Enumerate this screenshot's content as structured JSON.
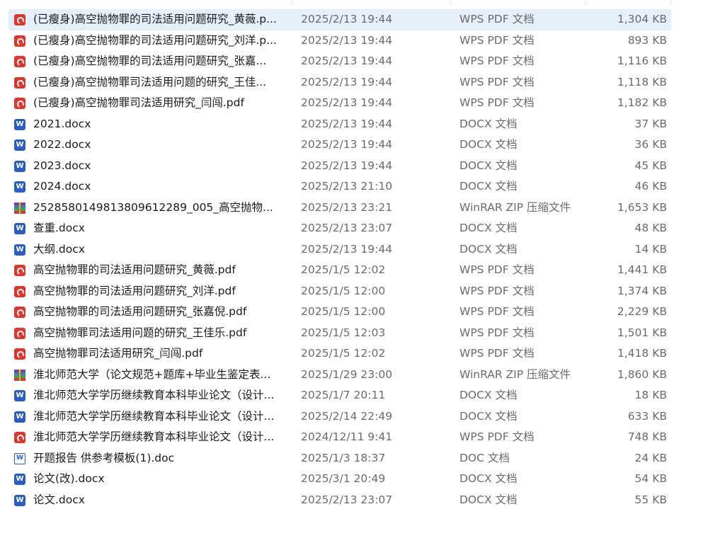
{
  "files": [
    {
      "name": "(已瘦身)高空抛物罪的司法适用问题研究_黄薇.p...",
      "date": "2025/2/13 19:44",
      "type": "WPS PDF 文档",
      "size": "1,304 KB",
      "icon": "pdf-icon",
      "selected": true
    },
    {
      "name": "(已瘦身)高空抛物罪的司法适用问题研究_刘洋.p...",
      "date": "2025/2/13 19:44",
      "type": "WPS PDF 文档",
      "size": "893 KB",
      "icon": "pdf-icon"
    },
    {
      "name": "(已瘦身)高空抛物罪的司法适用问题研究_张嘉...",
      "date": "2025/2/13 19:44",
      "type": "WPS PDF 文档",
      "size": "1,116 KB",
      "icon": "pdf-icon"
    },
    {
      "name": "(已瘦身)高空抛物罪司法适用问题的研究_王佳...",
      "date": "2025/2/13 19:44",
      "type": "WPS PDF 文档",
      "size": "1,118 KB",
      "icon": "pdf-icon"
    },
    {
      "name": "(已瘦身)高空抛物罪司法适用研究_闫闯.pdf",
      "date": "2025/2/13 19:44",
      "type": "WPS PDF 文档",
      "size": "1,182 KB",
      "icon": "pdf-icon"
    },
    {
      "name": "2021.docx",
      "date": "2025/2/13 19:44",
      "type": "DOCX 文档",
      "size": "37 KB",
      "icon": "docx-icon"
    },
    {
      "name": "2022.docx",
      "date": "2025/2/13 19:44",
      "type": "DOCX 文档",
      "size": "36 KB",
      "icon": "docx-icon"
    },
    {
      "name": "2023.docx",
      "date": "2025/2/13 19:44",
      "type": "DOCX 文档",
      "size": "45 KB",
      "icon": "docx-icon"
    },
    {
      "name": "2024.docx",
      "date": "2025/2/13 21:10",
      "type": "DOCX 文档",
      "size": "46 KB",
      "icon": "docx-icon"
    },
    {
      "name": "252858014981380961228​9_005_高空抛物...",
      "date": "2025/2/13 23:21",
      "type": "WinRAR ZIP 压缩文件",
      "size": "1,653 KB",
      "icon": "zip-icon"
    },
    {
      "name": "查重.docx",
      "date": "2025/2/13 23:07",
      "type": "DOCX 文档",
      "size": "48 KB",
      "icon": "docx-icon"
    },
    {
      "name": "大纲.docx",
      "date": "2025/2/13 19:44",
      "type": "DOCX 文档",
      "size": "14 KB",
      "icon": "docx-icon"
    },
    {
      "name": "高空抛物罪的司法适用问题研究_黄薇.pdf",
      "date": "2025/1/5 12:02",
      "type": "WPS PDF 文档",
      "size": "1,441 KB",
      "icon": "pdf-icon"
    },
    {
      "name": "高空抛物罪的司法适用问题研究_刘洋.pdf",
      "date": "2025/1/5 12:00",
      "type": "WPS PDF 文档",
      "size": "1,374 KB",
      "icon": "pdf-icon"
    },
    {
      "name": "高空抛物罪的司法适用问题研究_张嘉倪.pdf",
      "date": "2025/1/5 12:00",
      "type": "WPS PDF 文档",
      "size": "2,229 KB",
      "icon": "pdf-icon"
    },
    {
      "name": "高空抛物罪司法适用问题的研究_王佳乐.pdf",
      "date": "2025/1/5 12:03",
      "type": "WPS PDF 文档",
      "size": "1,501 KB",
      "icon": "pdf-icon"
    },
    {
      "name": "高空抛物罪司法适用研究_闫闯.pdf",
      "date": "2025/1/5 12:02",
      "type": "WPS PDF 文档",
      "size": "1,418 KB",
      "icon": "pdf-icon"
    },
    {
      "name": "淮北师范大学（论文规范+题库+毕业生鉴定表...",
      "date": "2025/1/29 23:00",
      "type": "WinRAR ZIP 压缩文件",
      "size": "1,860 KB",
      "icon": "zip-icon"
    },
    {
      "name": "淮北师范大学学历继续教育本科毕业论文（设计...",
      "date": "2025/1/7 20:11",
      "type": "DOCX 文档",
      "size": "18 KB",
      "icon": "docx-icon"
    },
    {
      "name": "淮北师范大学学历继续教育本科毕业论文（设计...",
      "date": "2025/2/14 22:49",
      "type": "DOCX 文档",
      "size": "633 KB",
      "icon": "docx-icon"
    },
    {
      "name": "淮北师范大学学历继续教育本科毕业论文（设计...",
      "date": "2024/12/11 9:41",
      "type": "WPS PDF 文档",
      "size": "748 KB",
      "icon": "pdf-icon"
    },
    {
      "name": "开题报告 供参考模板(1).doc",
      "date": "2025/1/3 18:37",
      "type": "DOC 文档",
      "size": "24 KB",
      "icon": "doc-icon"
    },
    {
      "name": "论文(改).docx",
      "date": "2025/3/1 20:49",
      "type": "DOCX 文档",
      "size": "54 KB",
      "icon": "docx-icon"
    },
    {
      "name": "论文.docx",
      "date": "2025/2/13 23:07",
      "type": "DOCX 文档",
      "size": "55 KB",
      "icon": "docx-icon"
    }
  ],
  "colors": {
    "selection": "#e5f0fb",
    "pdf": "#e0352b",
    "docx": "#2a5ccc"
  }
}
